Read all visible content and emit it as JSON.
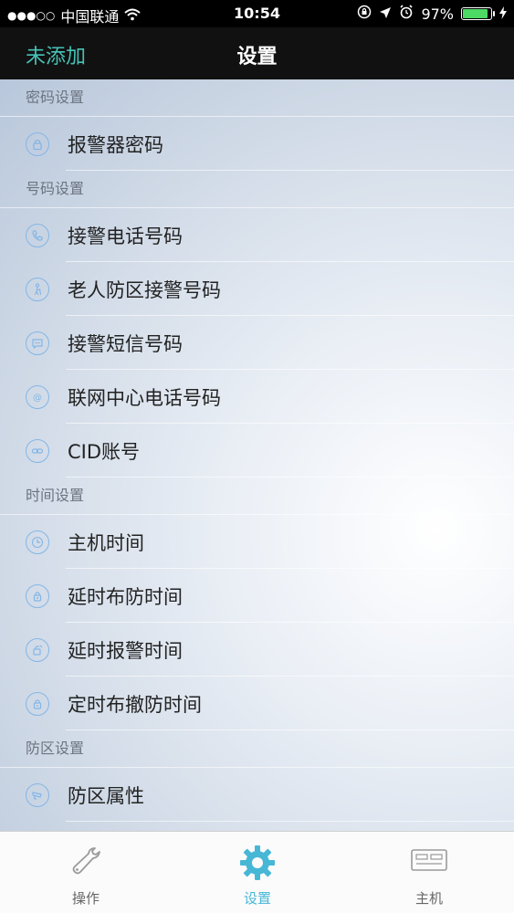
{
  "status_bar": {
    "signal_dots": "●●●○○",
    "carrier": "中国联通",
    "time": "10:54",
    "battery_percent": "97%",
    "battery_level": 0.97
  },
  "navbar": {
    "left_text": "未添加",
    "title": "设置"
  },
  "sections": [
    {
      "header": "密码设置",
      "items": [
        {
          "label": "报警器密码",
          "icon": "lock-icon"
        }
      ]
    },
    {
      "header": "号码设置",
      "items": [
        {
          "label": "接警电话号码",
          "icon": "phone-icon"
        },
        {
          "label": "老人防区接警号码",
          "icon": "elder-icon"
        },
        {
          "label": "接警短信号码",
          "icon": "message-icon"
        },
        {
          "label": "联网中心电话号码",
          "icon": "at-icon"
        },
        {
          "label": "CID账号",
          "icon": "link-icon"
        }
      ]
    },
    {
      "header": "时间设置",
      "items": [
        {
          "label": "主机时间",
          "icon": "clock-icon"
        },
        {
          "label": "延时布防时间",
          "icon": "lock-timer-icon"
        },
        {
          "label": "延时报警时间",
          "icon": "alarm-timer-icon"
        },
        {
          "label": "定时布撤防时间",
          "icon": "lock-schedule-icon"
        }
      ]
    },
    {
      "header": "防区设置",
      "items": [
        {
          "label": "防区属性",
          "icon": "camera-icon"
        }
      ]
    }
  ],
  "tabs": [
    {
      "label": "操作",
      "icon": "wrench-icon"
    },
    {
      "label": "设置",
      "icon": "gear-icon"
    },
    {
      "label": "主机",
      "icon": "host-device-icon"
    }
  ],
  "colors": {
    "accent": "#47c1b6",
    "active_tab": "#47b7d6",
    "icon_outline": "#84b6e6"
  }
}
